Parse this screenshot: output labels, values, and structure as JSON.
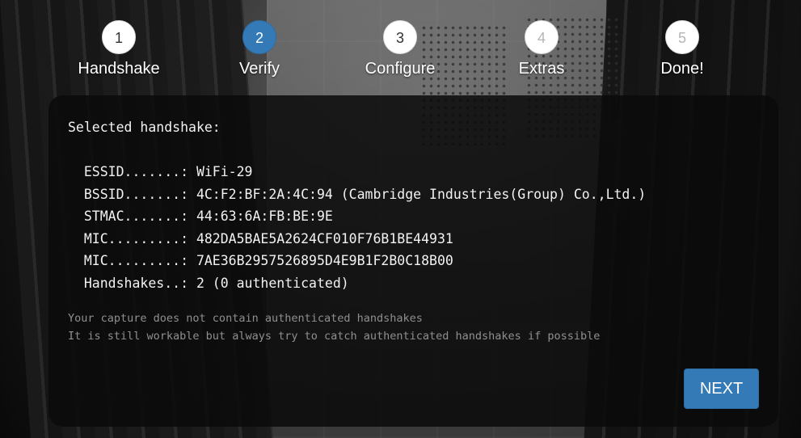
{
  "steps": [
    {
      "number": "1",
      "label": "Handshake",
      "state": "done"
    },
    {
      "number": "2",
      "label": "Verify",
      "state": "active"
    },
    {
      "number": "3",
      "label": "Configure",
      "state": "pending"
    },
    {
      "number": "4",
      "label": "Extras",
      "state": "future"
    },
    {
      "number": "5",
      "label": "Done!",
      "state": "future"
    }
  ],
  "panel": {
    "heading": "Selected handshake:",
    "lines": [
      "  ESSID.......: WiFi-29",
      "  BSSID.......: 4C:F2:BF:2A:4C:94 (Cambridge Industries(Group) Co.,Ltd.)",
      "  STMAC.......: 44:63:6A:FB:BE:9E",
      "  MIC.........: 482DA5BAE5A2624CF010F76B1BE44931",
      "  MIC.........: 7AE36B2957526895D4E9B1F2B0C18B00",
      "  Handshakes..: 2 (0 authenticated)"
    ],
    "notes": [
      "Your capture does not contain authenticated handshakes",
      "It is still workable but always try to catch authenticated handshakes if possible"
    ],
    "next_label": "NEXT"
  },
  "colors": {
    "accent": "#337ab7",
    "panel_bg": "#0a0a0a",
    "note_text": "#8f8f8f"
  }
}
